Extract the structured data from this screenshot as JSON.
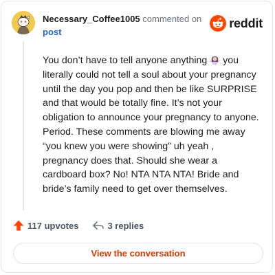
{
  "comment": {
    "username": "Necessary_Coffee1005",
    "action": "commented on",
    "post_link": "post",
    "brand": "reddit",
    "text_1": "You don’t have to tell anyone anything",
    "text_2": " you literally could not tell a soul about your pregnancy until the day you pop and then be like SURPRISE and that would be totally fine. It’s not your obligation to announce your pregnancy to anyone. Period. These comments are blowing me away “you knew you were showing” uh yeah , pregnancy does that. Should she wear a cardboard box? No! NTA NTA NTA! Bride and bride’s family need to get over themselves.",
    "emoji": "woman-shrugging-emoji"
  },
  "footer": {
    "upvotes": "117 upvotes",
    "replies": "3 replies"
  },
  "cta": {
    "label": "View the conversation"
  },
  "colors": {
    "accent": "#ff4500",
    "link": "#2563c9",
    "cta_text": "#d93a00",
    "border": "#e3e6e8"
  },
  "icons": {
    "avatar": "snoo-avatar-icon",
    "logo": "reddit-logo-icon",
    "upvote": "upvote-arrow-icon",
    "reply": "reply-arrow-icon"
  }
}
